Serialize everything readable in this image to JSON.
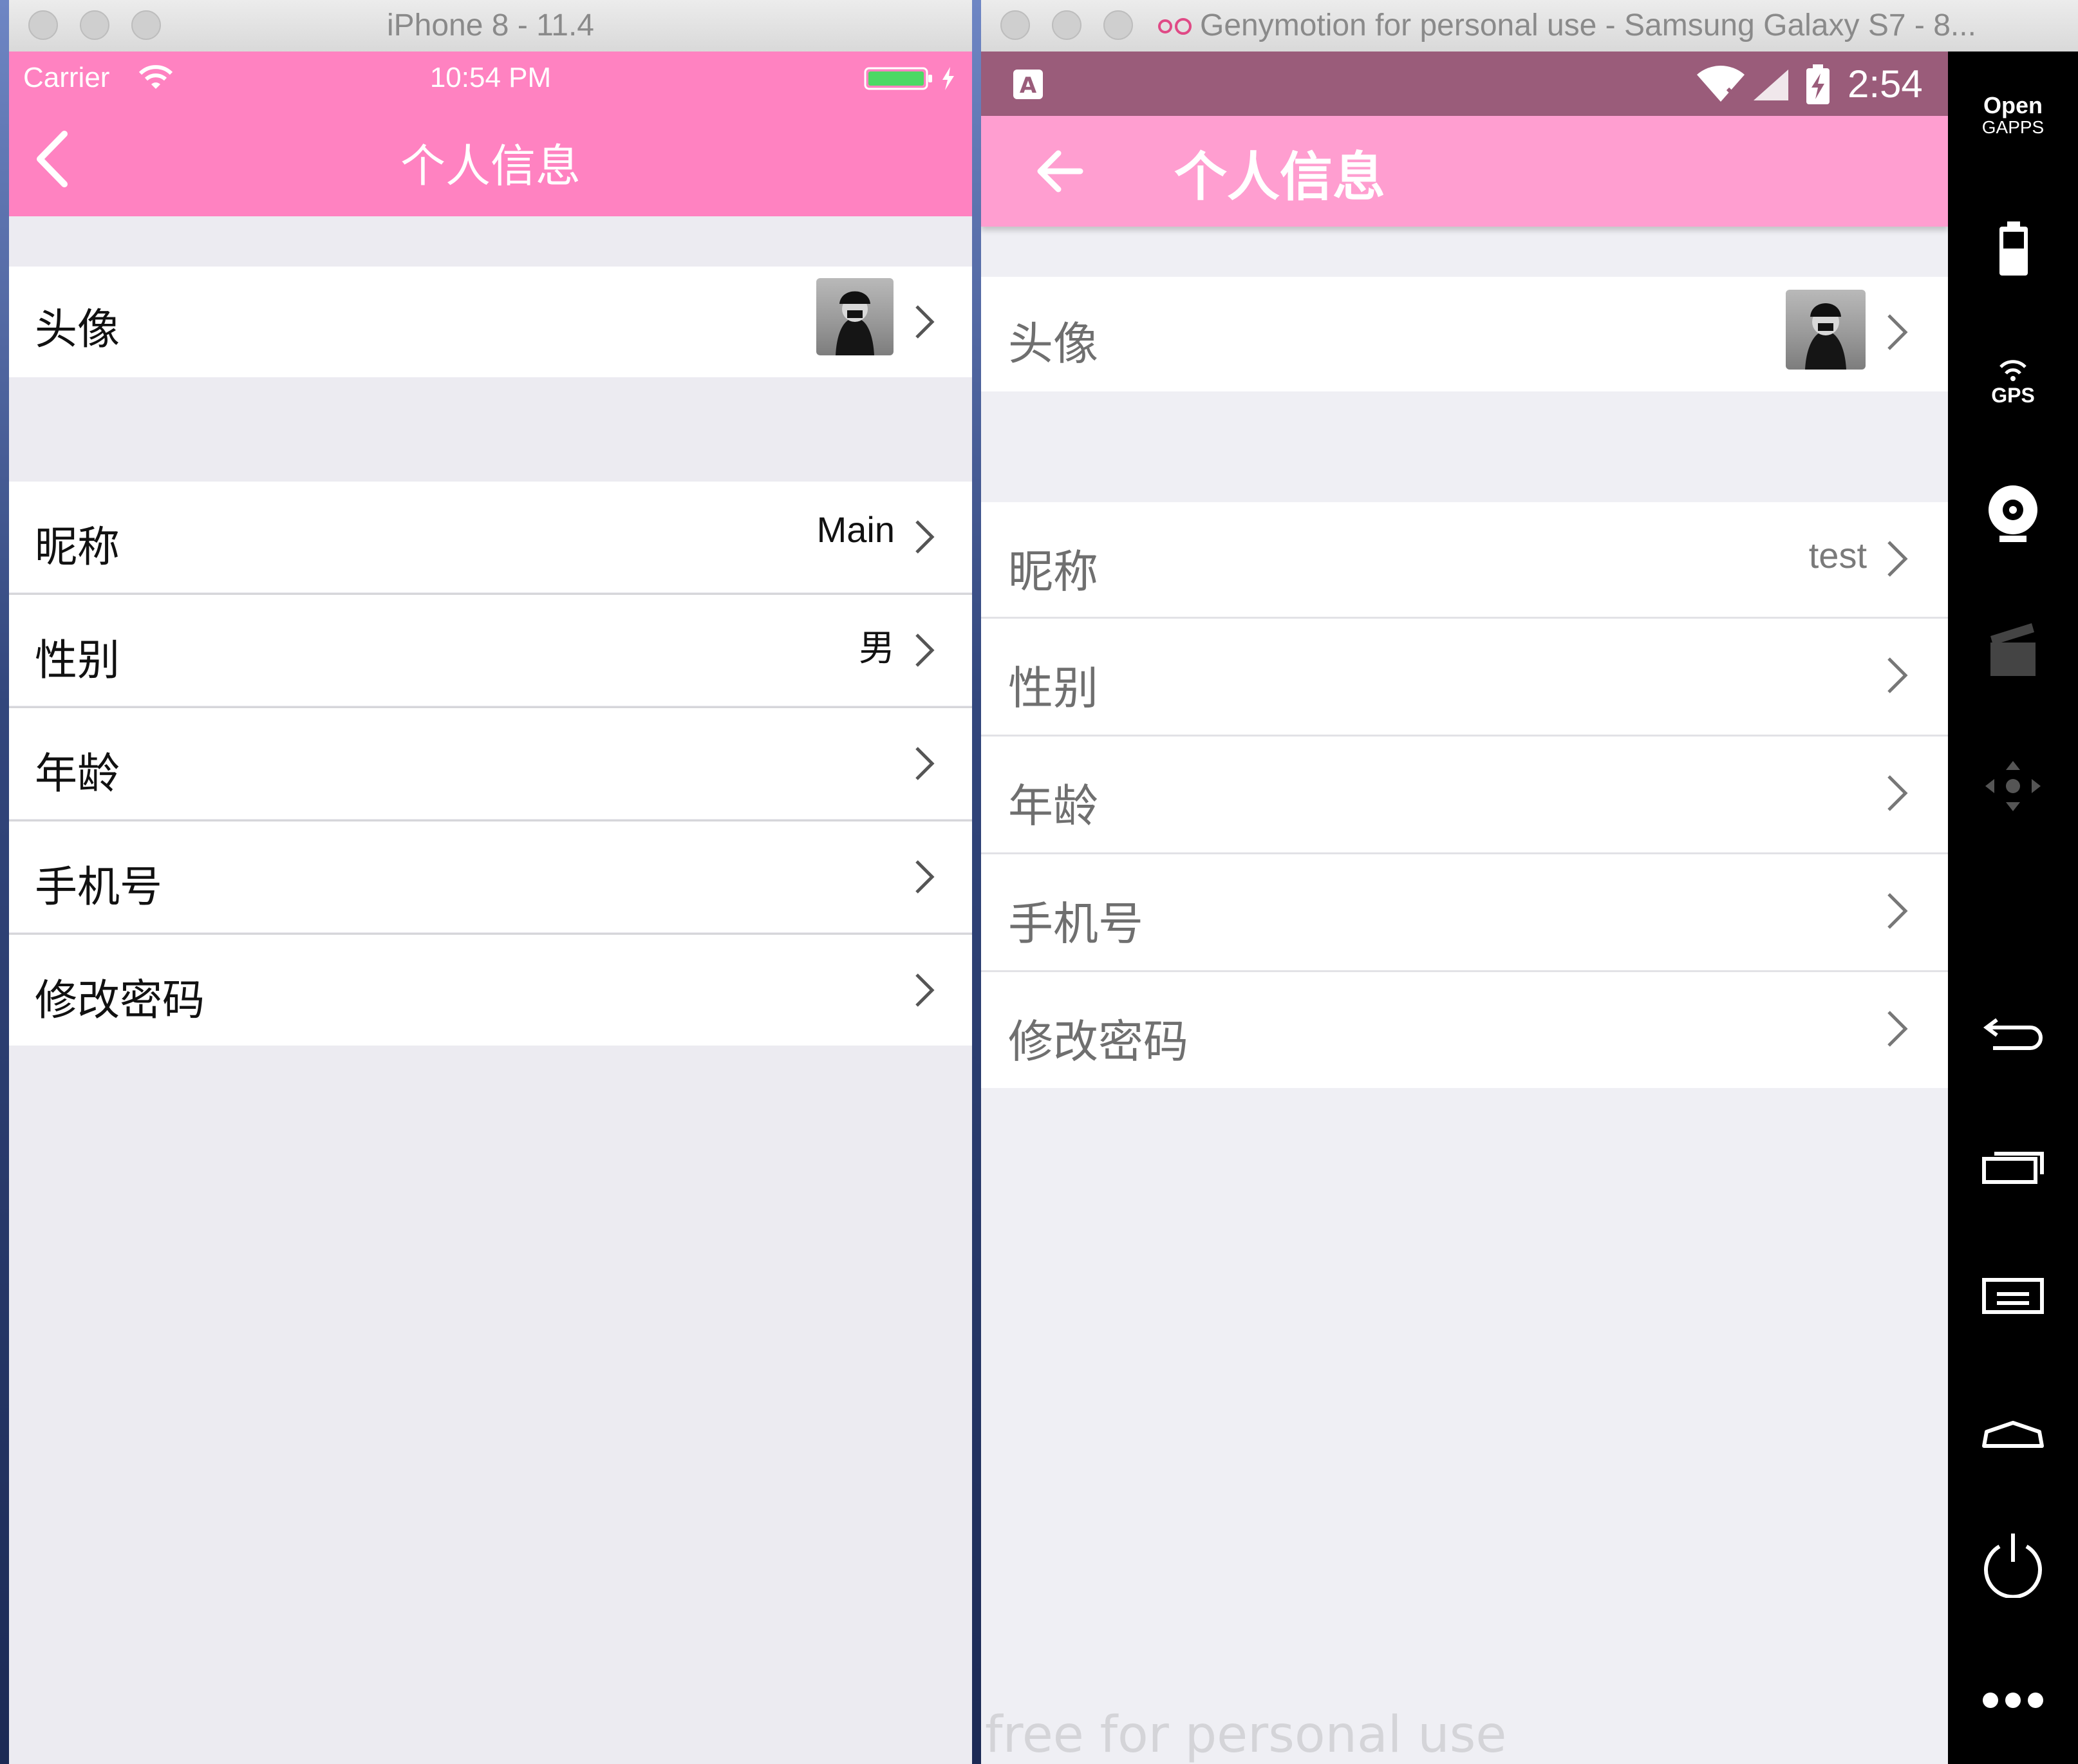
{
  "ios": {
    "window_title": "iPhone 8 - 11.4",
    "carrier": "Carrier",
    "time": "10:54 PM",
    "nav_title": "个人信息",
    "rows": [
      {
        "label": "头像",
        "value": ""
      },
      {
        "label": "昵称",
        "value": "Main"
      },
      {
        "label": "性别",
        "value": "男"
      },
      {
        "label": "年龄",
        "value": ""
      },
      {
        "label": "手机号",
        "value": ""
      },
      {
        "label": "修改密码",
        "value": ""
      }
    ],
    "colors": {
      "accent": "#ff82c1",
      "background": "#ecebf1",
      "battery": "#4cd964"
    },
    "icons": [
      "wifi-icon",
      "battery-icon",
      "charging-bolt-icon",
      "back-chevron-icon",
      "chevron-right-icon"
    ]
  },
  "android": {
    "window_title": "Genymotion for personal use - Samsung Galaxy S7 - 8...",
    "time": "2:54",
    "nav_title": "个人信息",
    "rows": [
      {
        "label": "头像",
        "value": ""
      },
      {
        "label": "昵称",
        "value": "test"
      },
      {
        "label": "性别",
        "value": ""
      },
      {
        "label": "年龄",
        "value": ""
      },
      {
        "label": "手机号",
        "value": ""
      },
      {
        "label": "修改密码",
        "value": ""
      }
    ],
    "watermark": "free for personal use",
    "colors": {
      "statusbar": "#9a5c7a",
      "toolbar": "#ff9ed0",
      "background": "#efeff4"
    },
    "sidebar": {
      "opengapps_line1": "Open",
      "opengapps_line2": "GAPPS",
      "gps_label": "GPS",
      "icons": [
        "opengapps-icon",
        "battery-icon",
        "gps-icon",
        "webcam-icon",
        "screencast-icon",
        "dpad-icon",
        "back-icon",
        "recent-apps-icon",
        "menu-icon",
        "home-icon",
        "power-icon",
        "more-icon"
      ]
    }
  }
}
